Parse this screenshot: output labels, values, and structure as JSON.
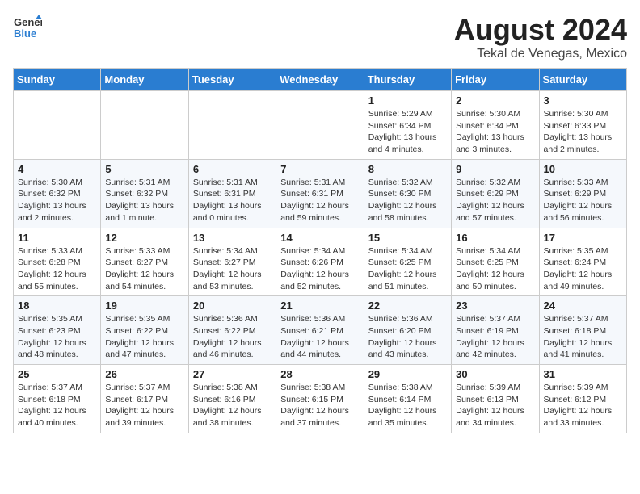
{
  "logo": {
    "line1": "General",
    "line2": "Blue"
  },
  "title": "August 2024",
  "subtitle": "Tekal de Venegas, Mexico",
  "days_header": [
    "Sunday",
    "Monday",
    "Tuesday",
    "Wednesday",
    "Thursday",
    "Friday",
    "Saturday"
  ],
  "weeks": [
    [
      {
        "day": "",
        "info": ""
      },
      {
        "day": "",
        "info": ""
      },
      {
        "day": "",
        "info": ""
      },
      {
        "day": "",
        "info": ""
      },
      {
        "day": "1",
        "info": "Sunrise: 5:29 AM\nSunset: 6:34 PM\nDaylight: 13 hours\nand 4 minutes."
      },
      {
        "day": "2",
        "info": "Sunrise: 5:30 AM\nSunset: 6:34 PM\nDaylight: 13 hours\nand 3 minutes."
      },
      {
        "day": "3",
        "info": "Sunrise: 5:30 AM\nSunset: 6:33 PM\nDaylight: 13 hours\nand 2 minutes."
      }
    ],
    [
      {
        "day": "4",
        "info": "Sunrise: 5:30 AM\nSunset: 6:32 PM\nDaylight: 13 hours\nand 2 minutes."
      },
      {
        "day": "5",
        "info": "Sunrise: 5:31 AM\nSunset: 6:32 PM\nDaylight: 13 hours\nand 1 minute."
      },
      {
        "day": "6",
        "info": "Sunrise: 5:31 AM\nSunset: 6:31 PM\nDaylight: 13 hours\nand 0 minutes."
      },
      {
        "day": "7",
        "info": "Sunrise: 5:31 AM\nSunset: 6:31 PM\nDaylight: 12 hours\nand 59 minutes."
      },
      {
        "day": "8",
        "info": "Sunrise: 5:32 AM\nSunset: 6:30 PM\nDaylight: 12 hours\nand 58 minutes."
      },
      {
        "day": "9",
        "info": "Sunrise: 5:32 AM\nSunset: 6:29 PM\nDaylight: 12 hours\nand 57 minutes."
      },
      {
        "day": "10",
        "info": "Sunrise: 5:33 AM\nSunset: 6:29 PM\nDaylight: 12 hours\nand 56 minutes."
      }
    ],
    [
      {
        "day": "11",
        "info": "Sunrise: 5:33 AM\nSunset: 6:28 PM\nDaylight: 12 hours\nand 55 minutes."
      },
      {
        "day": "12",
        "info": "Sunrise: 5:33 AM\nSunset: 6:27 PM\nDaylight: 12 hours\nand 54 minutes."
      },
      {
        "day": "13",
        "info": "Sunrise: 5:34 AM\nSunset: 6:27 PM\nDaylight: 12 hours\nand 53 minutes."
      },
      {
        "day": "14",
        "info": "Sunrise: 5:34 AM\nSunset: 6:26 PM\nDaylight: 12 hours\nand 52 minutes."
      },
      {
        "day": "15",
        "info": "Sunrise: 5:34 AM\nSunset: 6:25 PM\nDaylight: 12 hours\nand 51 minutes."
      },
      {
        "day": "16",
        "info": "Sunrise: 5:34 AM\nSunset: 6:25 PM\nDaylight: 12 hours\nand 50 minutes."
      },
      {
        "day": "17",
        "info": "Sunrise: 5:35 AM\nSunset: 6:24 PM\nDaylight: 12 hours\nand 49 minutes."
      }
    ],
    [
      {
        "day": "18",
        "info": "Sunrise: 5:35 AM\nSunset: 6:23 PM\nDaylight: 12 hours\nand 48 minutes."
      },
      {
        "day": "19",
        "info": "Sunrise: 5:35 AM\nSunset: 6:22 PM\nDaylight: 12 hours\nand 47 minutes."
      },
      {
        "day": "20",
        "info": "Sunrise: 5:36 AM\nSunset: 6:22 PM\nDaylight: 12 hours\nand 46 minutes."
      },
      {
        "day": "21",
        "info": "Sunrise: 5:36 AM\nSunset: 6:21 PM\nDaylight: 12 hours\nand 44 minutes."
      },
      {
        "day": "22",
        "info": "Sunrise: 5:36 AM\nSunset: 6:20 PM\nDaylight: 12 hours\nand 43 minutes."
      },
      {
        "day": "23",
        "info": "Sunrise: 5:37 AM\nSunset: 6:19 PM\nDaylight: 12 hours\nand 42 minutes."
      },
      {
        "day": "24",
        "info": "Sunrise: 5:37 AM\nSunset: 6:18 PM\nDaylight: 12 hours\nand 41 minutes."
      }
    ],
    [
      {
        "day": "25",
        "info": "Sunrise: 5:37 AM\nSunset: 6:18 PM\nDaylight: 12 hours\nand 40 minutes."
      },
      {
        "day": "26",
        "info": "Sunrise: 5:37 AM\nSunset: 6:17 PM\nDaylight: 12 hours\nand 39 minutes."
      },
      {
        "day": "27",
        "info": "Sunrise: 5:38 AM\nSunset: 6:16 PM\nDaylight: 12 hours\nand 38 minutes."
      },
      {
        "day": "28",
        "info": "Sunrise: 5:38 AM\nSunset: 6:15 PM\nDaylight: 12 hours\nand 37 minutes."
      },
      {
        "day": "29",
        "info": "Sunrise: 5:38 AM\nSunset: 6:14 PM\nDaylight: 12 hours\nand 35 minutes."
      },
      {
        "day": "30",
        "info": "Sunrise: 5:39 AM\nSunset: 6:13 PM\nDaylight: 12 hours\nand 34 minutes."
      },
      {
        "day": "31",
        "info": "Sunrise: 5:39 AM\nSunset: 6:12 PM\nDaylight: 12 hours\nand 33 minutes."
      }
    ]
  ]
}
